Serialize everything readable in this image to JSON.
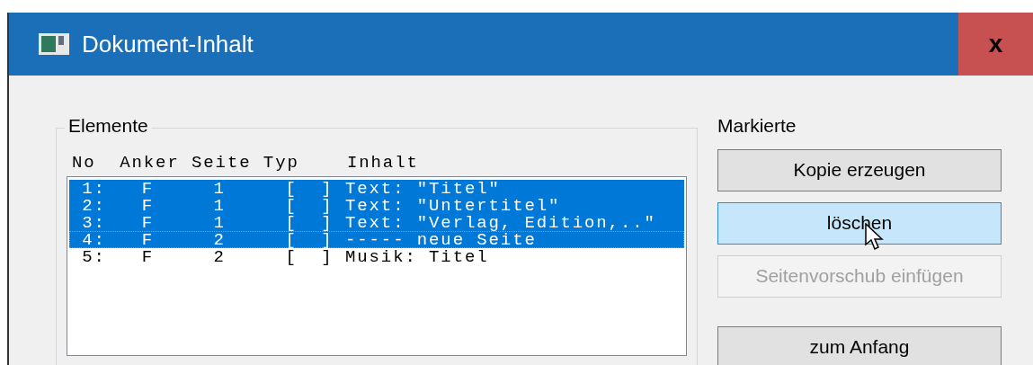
{
  "window": {
    "title": "Dokument-Inhalt",
    "close": "x"
  },
  "elements": {
    "label": "Elemente",
    "header": "No  Anker Seite Typ    Inhalt",
    "rows": [
      {
        "text": " 1:   F     1     [  ] Text: \"Titel\"",
        "selected": true,
        "focused": false
      },
      {
        "text": " 2:   F     1     [  ] Text: \"Untertitel\"",
        "selected": true,
        "focused": false
      },
      {
        "text": " 3:   F     1     [  ] Text: \"Verlag, Edition,..\"",
        "selected": true,
        "focused": false
      },
      {
        "text": " 4:   F     2     [  ] ----- neue Seite",
        "selected": true,
        "focused": true
      },
      {
        "text": " 5:   F     2     [  ] Musik: Titel",
        "selected": false,
        "focused": false
      }
    ]
  },
  "marked": {
    "label": "Markierte",
    "buttons": [
      {
        "label": "Kopie erzeugen",
        "hovered": false,
        "disabled": false
      },
      {
        "label": "löschen",
        "hovered": true,
        "disabled": false
      },
      {
        "label": "Seitenvorschub einfügen",
        "hovered": false,
        "disabled": true
      }
    ],
    "start_button": {
      "label": "zum Anfang"
    }
  }
}
